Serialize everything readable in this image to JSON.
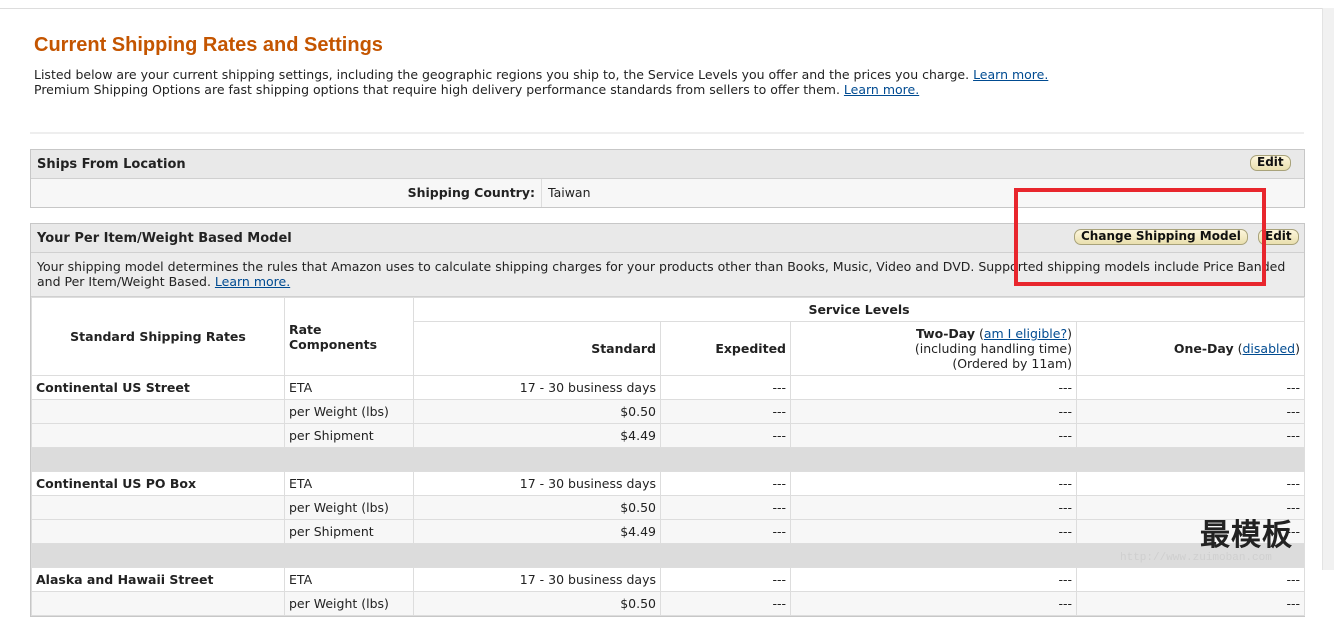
{
  "page": {
    "title": "Current Shipping Rates and Settings",
    "intro_line1": "Listed below are your current shipping settings, including the geographic regions you ship to, the Service Levels you offer and the prices you charge.",
    "intro_line1_link": "Learn more.",
    "intro_line2": "Premium Shipping Options are fast shipping options that require high delivery performance standards from sellers to offer them.",
    "intro_line2_link": "Learn more."
  },
  "ships_from": {
    "header": "Ships From Location",
    "edit_label": "Edit",
    "country_label": "Shipping Country:",
    "country_value": "Taiwan"
  },
  "model": {
    "header": "Your Per Item/Weight Based Model",
    "change_label": "Change Shipping Model",
    "edit_label": "Edit",
    "description": "Your shipping model determines the rules that Amazon uses to calculate shipping charges for your products other than Books, Music, Video and DVD. Supported shipping models include Price Banded and Per Item/Weight Based.",
    "description_link": "Learn more."
  },
  "table": {
    "col_rates": "Standard Shipping Rates",
    "col_components": "Rate Components",
    "service_levels": "Service Levels",
    "standard": "Standard",
    "expedited": "Expedited",
    "two_day": "Two-Day",
    "two_day_link": "am I eligible?",
    "two_day_note1": "(including handling time)",
    "two_day_note2": "(Ordered by 11am)",
    "one_day": "One-Day",
    "one_day_link": "disabled",
    "groups": [
      {
        "region": "Continental US Street",
        "rows": [
          {
            "component": "ETA",
            "standard": "17 - 30 business days",
            "expedited": "---",
            "two_day": "---",
            "one_day": "---"
          },
          {
            "component": "per Weight (lbs)",
            "standard": "$0.50",
            "expedited": "---",
            "two_day": "---",
            "one_day": "---"
          },
          {
            "component": "per Shipment",
            "standard": "$4.49",
            "expedited": "---",
            "two_day": "---",
            "one_day": "---"
          }
        ]
      },
      {
        "region": "Continental US PO Box",
        "rows": [
          {
            "component": "ETA",
            "standard": "17 - 30 business days",
            "expedited": "---",
            "two_day": "---",
            "one_day": "---"
          },
          {
            "component": "per Weight (lbs)",
            "standard": "$0.50",
            "expedited": "---",
            "two_day": "---",
            "one_day": "---"
          },
          {
            "component": "per Shipment",
            "standard": "$4.49",
            "expedited": "---",
            "two_day": "---",
            "one_day": "---"
          }
        ]
      },
      {
        "region": "Alaska and Hawaii Street",
        "rows": [
          {
            "component": "ETA",
            "standard": "17 - 30 business days",
            "expedited": "---",
            "two_day": "---",
            "one_day": "---"
          },
          {
            "component": "per Weight (lbs)",
            "standard": "$0.50",
            "expedited": "---",
            "two_day": "---",
            "one_day": "---"
          }
        ]
      }
    ]
  },
  "watermark": {
    "text": "最模板",
    "url": "http://www.zuimoban.com"
  },
  "colors": {
    "title": "#c45500",
    "link": "#004b91",
    "highlight": "#e8262d"
  }
}
